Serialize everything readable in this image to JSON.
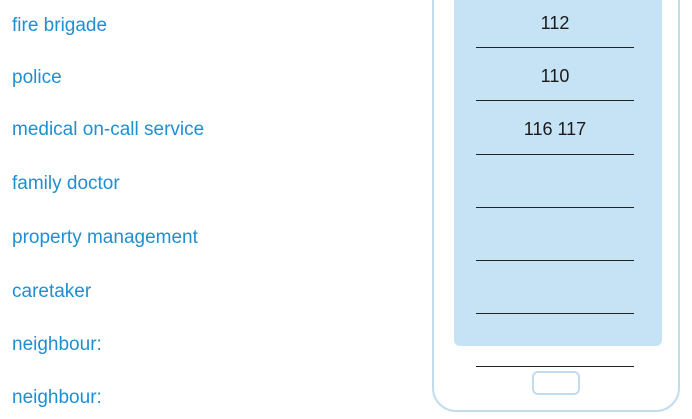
{
  "contacts": [
    {
      "label": "fire brigade",
      "number": "112"
    },
    {
      "label": "police",
      "number": "110"
    },
    {
      "label": "medical on-call service",
      "number": "116 117"
    },
    {
      "label": "family doctor",
      "number": ""
    },
    {
      "label": "property management",
      "number": ""
    },
    {
      "label": "caretaker",
      "number": ""
    },
    {
      "label": "neighbour:",
      "number": ""
    },
    {
      "label": "neighbour:",
      "number": ""
    }
  ]
}
